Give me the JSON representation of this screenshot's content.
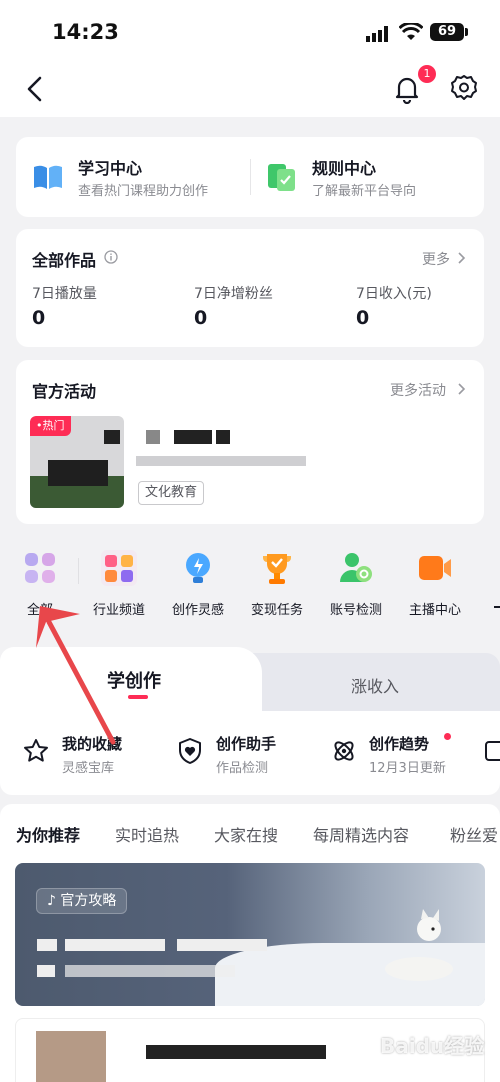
{
  "status_bar": {
    "time": "14:23",
    "battery": "69"
  },
  "nav": {
    "notification_count": "1"
  },
  "links": [
    {
      "title": "学习中心",
      "subtitle": "查看热门课程助力创作"
    },
    {
      "title": "规则中心",
      "subtitle": "了解最新平台导向"
    }
  ],
  "works": {
    "title": "全部作品",
    "more": "更多",
    "stats": [
      {
        "label": "7日播放量",
        "value": "0"
      },
      {
        "label": "7日净增粉丝",
        "value": "0"
      },
      {
        "label": "7日收入(元)",
        "value": "0"
      }
    ]
  },
  "activity": {
    "title": "官方活动",
    "more": "更多活动",
    "hot_tag": "热门",
    "category_tag": "文化教育"
  },
  "shortcuts": [
    {
      "label": "全部",
      "icon": "grid-icon"
    },
    {
      "label": "行业频道",
      "icon": "industry-channel-icon"
    },
    {
      "label": "创作灵感",
      "icon": "lightbulb-icon"
    },
    {
      "label": "变现任务",
      "icon": "trophy-icon"
    },
    {
      "label": "账号检测",
      "icon": "account-check-icon"
    },
    {
      "label": "主播中心",
      "icon": "video-camera-icon"
    }
  ],
  "section_tabs": [
    "学创作",
    "涨收入"
  ],
  "tools": [
    {
      "title": "我的收藏",
      "subtitle": "灵感宝库",
      "icon": "star-icon"
    },
    {
      "title": "创作助手",
      "subtitle": "作品检测",
      "icon": "shield-heart-icon"
    },
    {
      "title": "创作趋势",
      "subtitle": "12月3日更新",
      "icon": "trend-atom-icon"
    }
  ],
  "feed_tabs": [
    "为你推荐",
    "实时追热",
    "大家在搜",
    "每周精选内容",
    "粉丝爱"
  ],
  "feed": {
    "official_tag": "官方攻略"
  },
  "colors": {
    "accent": "#fe2c55",
    "annotation_arrow": "#e8474b"
  },
  "watermark": "Baidu经验"
}
